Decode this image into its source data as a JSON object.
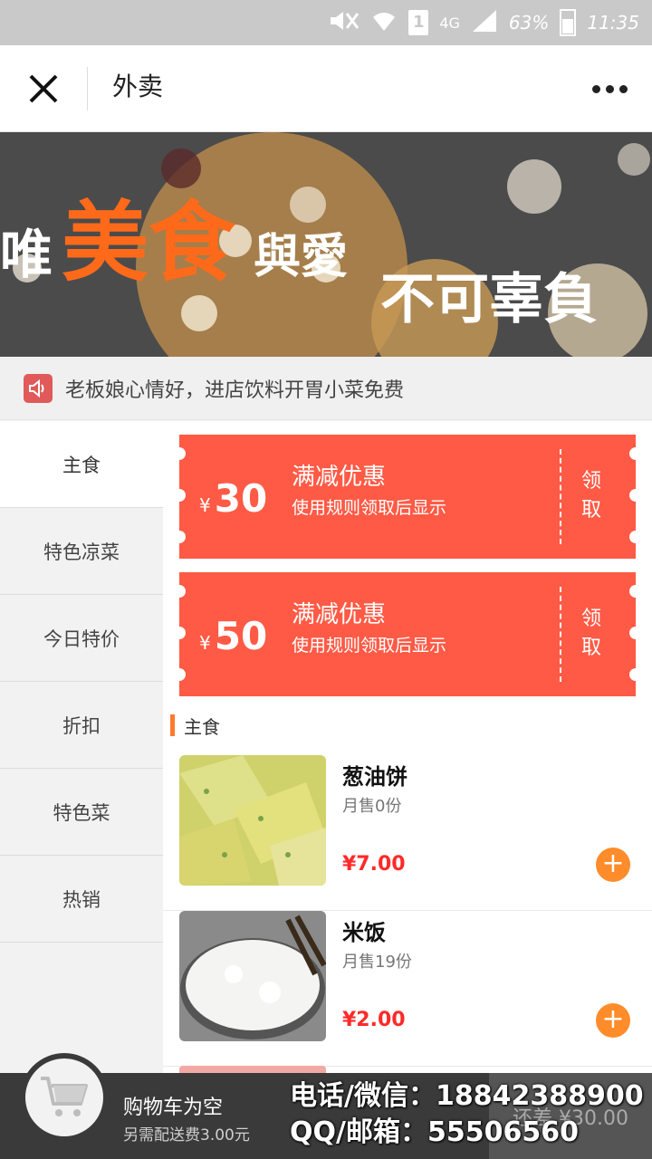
{
  "status_bar": {
    "network": "4G",
    "sim": "1",
    "battery": "63%",
    "time": "11:35"
  },
  "header": {
    "title": "外卖",
    "close_icon": "close-icon",
    "more_icon": "more-icon"
  },
  "banner": {
    "line1_a": "唯",
    "line1_highlight": "美食",
    "line1_b": "與愛",
    "line2": "不可辜負",
    "highlight_color": "#ff6a1a"
  },
  "notice": {
    "icon": "speaker-icon",
    "text": "老板娘心情好，进店饮料开胃小菜免费"
  },
  "categories": [
    {
      "label": "主食",
      "active": true
    },
    {
      "label": "特色凉菜",
      "active": false
    },
    {
      "label": "今日特价",
      "active": false
    },
    {
      "label": "折扣",
      "active": false
    },
    {
      "label": "特色菜",
      "active": false
    },
    {
      "label": "热销",
      "active": false
    }
  ],
  "coupons": [
    {
      "currency": "¥",
      "amount": "30",
      "title": "满减优惠",
      "desc": "使用规则领取后显示",
      "claim": "领取"
    },
    {
      "currency": "¥",
      "amount": "50",
      "title": "满减优惠",
      "desc": "使用规则领取后显示",
      "claim": "领取"
    }
  ],
  "section": {
    "title": "主食"
  },
  "products": [
    {
      "name": "葱油饼",
      "sales": "月售0份",
      "price": "¥7.00",
      "image": "scallion-pancake"
    },
    {
      "name": "米饭",
      "sales": "月售19份",
      "price": "¥2.00",
      "image": "rice-bowl"
    }
  ],
  "cart": {
    "title": "购物车为空",
    "subtitle": "另需配送费3.00元",
    "checkout": "还差 ¥30.00",
    "icon": "cart-icon"
  },
  "contact": {
    "line1": "电话/微信：18842388900",
    "line2": "QQ/邮箱：55506560"
  },
  "colors": {
    "accent": "#ff5a45",
    "price": "#ff2a2a",
    "add_button": "#ff8c2a",
    "bottom_bar": "#3a3a3a"
  }
}
